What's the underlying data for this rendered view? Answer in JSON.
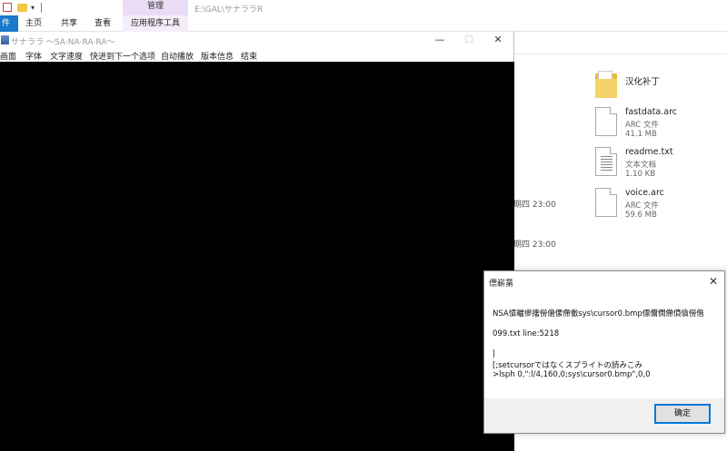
{
  "explorer": {
    "manage_tab": "管理",
    "path_title": "E:\\GAL\\サナララR",
    "ribbon_tabs": [
      "件",
      "主页",
      "共享",
      "查看",
      "应用程序工具"
    ],
    "files": [
      {
        "name": "汉化补丁",
        "type": "",
        "size": ""
      },
      {
        "name": "fastdata.arc",
        "type": "ARC 文件",
        "size": "41.1 MB"
      },
      {
        "name": "readme.txt",
        "type": "文本文档",
        "size": "1.10 KB"
      },
      {
        "name": "voice.arc",
        "type": "ARC 文件",
        "size": "59.6 MB"
      }
    ],
    "dates": [
      "期四 23:00",
      "期四 23:00"
    ]
  },
  "game": {
    "title": "サナララ ～SA·NA·RA·RA～",
    "window_buttons": {
      "minimize": "—",
      "maximize": "☐",
      "close": "✕"
    },
    "menu": [
      "画面",
      "字体",
      "文字速度",
      "快进到下一个选项",
      "自动播放",
      "版本信息",
      "结束"
    ]
  },
  "dialog": {
    "title": "僄嶄晜",
    "close": "✕",
    "lines": [
      "NSA憤曬傪撦僗僒傫僀僘sys\\cursor0.bmp僄儞僩僀僨僋僗偺",
      "099.txt line:5218",
      "|",
      "[;setcursorではなくスプライトの読みこみ",
      ">lsph 0,\":l/4,160,0;sys\\cursor0.bmp\",0,0"
    ],
    "ok_label": "确定"
  }
}
